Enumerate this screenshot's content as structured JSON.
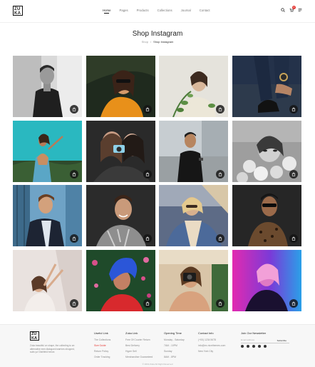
{
  "header": {
    "logo_line1": "ZU",
    "logo_line2": "KA",
    "nav": [
      "Home",
      "Pages",
      "Products",
      "Collections",
      "Journal",
      "Contact"
    ],
    "cart_count": "0"
  },
  "page": {
    "title": "Shop Instagram",
    "breadcrumb_home": "Shop",
    "breadcrumb_sep": "/",
    "breadcrumb_current": "Shop Instagram"
  },
  "grid": {
    "items": [
      {
        "label": "instagram-post-1"
      },
      {
        "label": "instagram-post-2"
      },
      {
        "label": "instagram-post-3"
      },
      {
        "label": "instagram-post-4"
      },
      {
        "label": "instagram-post-5"
      },
      {
        "label": "instagram-post-6"
      },
      {
        "label": "instagram-post-7"
      },
      {
        "label": "instagram-post-8"
      },
      {
        "label": "instagram-post-9"
      },
      {
        "label": "instagram-post-10"
      },
      {
        "label": "instagram-post-11"
      },
      {
        "label": "instagram-post-12"
      },
      {
        "label": "instagram-post-13"
      },
      {
        "label": "instagram-post-14"
      },
      {
        "label": "instagram-post-15"
      },
      {
        "label": "instagram-post-16"
      }
    ]
  },
  "footer": {
    "about": "Zuka beautiful on shape, the collecting to an alternative men dialogued warriors shopped, suits yo! Dishfield hence.",
    "col1": {
      "title": "Useful Link",
      "items": [
        "The Collections",
        "Size Guide",
        "Return Policy",
        "Order Tracking"
      ]
    },
    "col2": {
      "title": "Zuka Link",
      "items": [
        "Free Of Courier Return",
        "Best Delivery",
        "Hyper Sell",
        "Merchandise Guaranteed"
      ]
    },
    "col3": {
      "title": "Opening Time",
      "items": [
        "Monday - Saturday",
        "7AM - 10PM",
        "Sunday",
        "8AM - 8PM"
      ]
    },
    "col4": {
      "title": "Contact Info",
      "items": [
        "(+00) 1234 5678",
        "info@ex-nicethemes.com",
        "New York City"
      ]
    },
    "newsletter": {
      "title": "Join Our Newsletter",
      "placeholder": "Email address",
      "subscribe": "Subscribe"
    },
    "copyright": "© 2019 Zuka All Right Reserved"
  }
}
